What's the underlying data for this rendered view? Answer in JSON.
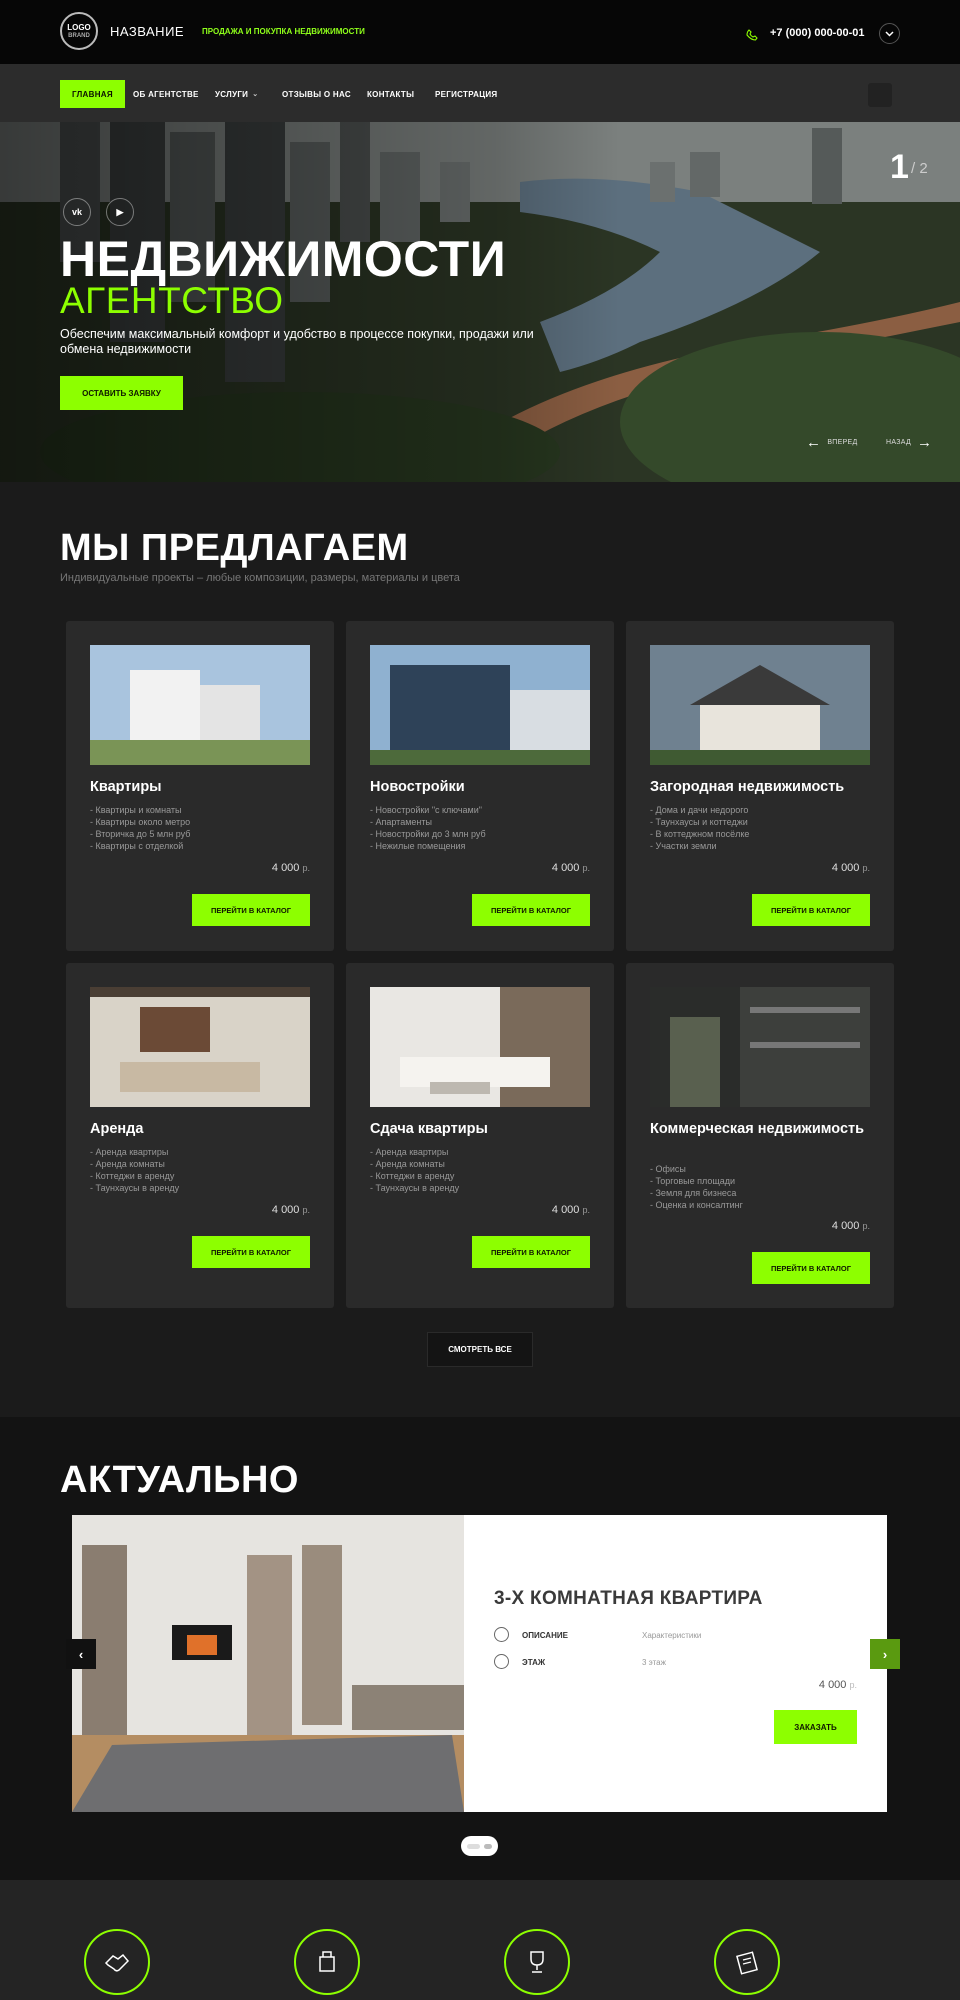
{
  "header": {
    "logo_line1": "LOGO",
    "logo_line2": "BRAND",
    "brand_name": "НАЗВАНИЕ",
    "tagline": "ПРОДАЖА И ПОКУПКА НЕДВИЖИМОСТИ",
    "phone": "+7 (000) 000-00-01",
    "phone_icon": "phone-icon",
    "dropdown_icon": "chevron-down-icon"
  },
  "nav": {
    "items": [
      {
        "label": "ГЛАВНАЯ",
        "active": true
      },
      {
        "label": "ОБ АГЕНТСТВЕ"
      },
      {
        "label": "УСЛУГИ",
        "caret": "⌄"
      },
      {
        "label": "ОТЗЫВЫ О НАС"
      },
      {
        "label": "КОНТАКТЫ"
      },
      {
        "label": "РЕГИСТРАЦИЯ"
      }
    ]
  },
  "hero": {
    "social": [
      "vk-icon",
      "youtube-icon"
    ],
    "vk_label": "vk",
    "yt_label": "▶",
    "title": "НЕДВИЖИМОСТИ",
    "subtitle": "АГЕНТСТВО",
    "description": "Обеспечим максимальный комфорт и удобство в процессе покупки, продажи или обмена недвижимости",
    "button": "ОСТАВИТЬ ЗАЯВКУ",
    "slide_current": "1",
    "slide_total": "/ 2",
    "prev_label": "ВПЕРЕД",
    "next_label": "НАЗАД",
    "prev_arrow": "←",
    "next_arrow": "→"
  },
  "offers": {
    "title": "МЫ ПРЕДЛАГАЕМ",
    "subtitle": "Индивидуальные проекты – любые композиции, размеры, материалы и цвета",
    "cards": [
      {
        "title": "Квартиры",
        "features": [
          "- Квартиры и комнаты",
          "- Квартиры около метро",
          "- Вторичка до 5 млн руб",
          "- Квартиры с отделкой"
        ],
        "price": "4 000",
        "currency": "р.",
        "button": "ПЕРЕЙТИ В КАТАЛОГ"
      },
      {
        "title": "Новостройки",
        "features": [
          "- Новостройки \"с ключами\"",
          "- Апартаменты",
          "- Новостройки до 3 млн руб",
          "- Нежилые помещения"
        ],
        "price": "4 000",
        "currency": "р.",
        "button": "ПЕРЕЙТИ В КАТАЛОГ"
      },
      {
        "title": "Загородная недвижимость",
        "features": [
          "- Дома и дачи недорого",
          "- Таунхаусы и коттеджи",
          "- В коттеджном посёлке",
          "- Участки земли"
        ],
        "price": "4 000",
        "currency": "р.",
        "button": "ПЕРЕЙТИ В КАТАЛОГ"
      },
      {
        "title": "Аренда",
        "features": [
          "- Аренда квартиры",
          "- Аренда комнаты",
          "- Коттеджи в аренду",
          "- Таунхаусы в аренду"
        ],
        "price": "4 000",
        "currency": "р.",
        "button": "ПЕРЕЙТИ В КАТАЛОГ"
      },
      {
        "title": "Сдача квартиры",
        "features": [
          "- Аренда квартиры",
          "- Аренда комнаты",
          "- Коттеджи в аренду",
          "- Таунхаусы в аренду"
        ],
        "price": "4 000",
        "currency": "р.",
        "button": "ПЕРЕЙТИ В КАТАЛОГ"
      },
      {
        "title": "Коммерческая недвижимость",
        "features": [
          "- Офисы",
          "- Торговые площади",
          "- Земля для бизнеса",
          "- Оценка и консалтинг"
        ],
        "price": "4 000",
        "currency": "р.",
        "button": "ПЕРЕЙТИ В КАТАЛОГ"
      }
    ],
    "see_all": "СМОТРЕТЬ ВСЕ"
  },
  "actual": {
    "title": "АКТУАЛЬНО",
    "item_title": "3-Х КОМНАТНАЯ КВАРТИРА",
    "rows": [
      {
        "icon": "award-icon",
        "label": "ОПИСАНИЕ",
        "value": "Характеристики"
      },
      {
        "icon": "target-icon",
        "label": "ЭТАЖ",
        "value": "3 этаж"
      }
    ],
    "price": "4 000",
    "currency": "р.",
    "button": "ЗАКАЗАТЬ",
    "prev_arrow": "‹",
    "next_arrow": "›"
  },
  "features": {
    "icons": [
      "handshake-icon",
      "cleaning-icon",
      "trophy-icon",
      "documents-icon"
    ]
  },
  "colors": {
    "accent": "#8dff00",
    "background": "#1b1b1b",
    "card": "#2a2a2a"
  }
}
